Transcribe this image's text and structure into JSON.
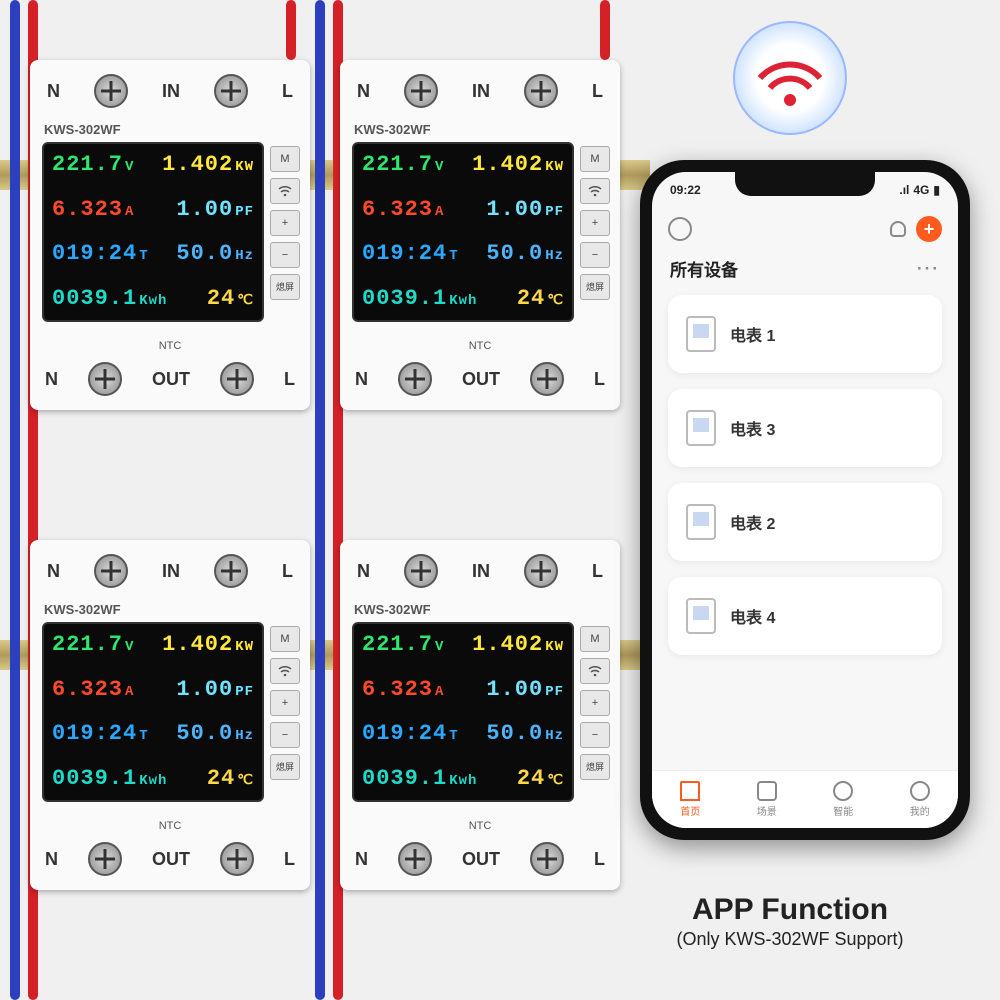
{
  "colors": {
    "volt": "#2ee66b",
    "amp": "#ff4a2a",
    "time": "#2aa8ff",
    "kwh": "#20d9c8",
    "power": "#ffe83d",
    "pf": "#6fe3ff",
    "hz": "#4db4ff",
    "temp": "#ffd84a"
  },
  "device": {
    "model": "KWS-302WF",
    "labels": {
      "n": "N",
      "in": "IN",
      "out": "OUT",
      "l": "L",
      "ntc": "NTC"
    },
    "buttons": {
      "m": "M",
      "plus": "+",
      "minus": "−",
      "screen": "熄屏"
    },
    "readings": {
      "volt": "221.7",
      "volt_u": "V",
      "power": "1.402",
      "power_u": "KW",
      "amp": "6.323",
      "amp_u": "A",
      "pf": "1.00",
      "pf_u": "PF",
      "time": "019:24",
      "time_u": "T",
      "hz": "50.0",
      "hz_u": "Hz",
      "kwh": "0039.1",
      "kwh_u": "Kwh",
      "temp": "24",
      "temp_u": "℃"
    }
  },
  "phone": {
    "time": "09:22",
    "signal": ".ıl",
    "carrier": "4G",
    "top": {
      "add": "+",
      "section": "所有设备",
      "more": "···"
    },
    "devices": [
      {
        "name": "电表 1"
      },
      {
        "name": "电表 3"
      },
      {
        "name": "电表 2"
      },
      {
        "name": "电表 4"
      }
    ],
    "tabs": [
      {
        "label": "首页",
        "active": true
      },
      {
        "label": "场景",
        "active": false
      },
      {
        "label": "智能",
        "active": false
      },
      {
        "label": "我的",
        "active": false
      }
    ]
  },
  "caption": {
    "title": "APP Function",
    "sub": "(Only KWS-302WF Support)"
  }
}
